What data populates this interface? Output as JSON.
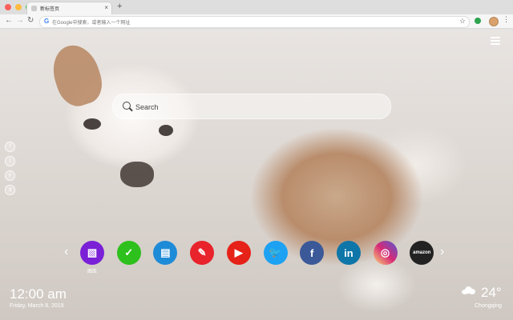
{
  "browser": {
    "tab_title": "新标签页",
    "tab_close": "×",
    "new_tab": "+",
    "omnibox_placeholder": "在Google中搜索，或者输入一个网址",
    "star": "☆",
    "menu": "⋮"
  },
  "page": {
    "search_placeholder": "Search",
    "social_icons": [
      "f",
      "t",
      "p",
      "g"
    ],
    "apps": [
      {
        "name": "gallery",
        "label": "图库",
        "glyph": "▧",
        "color": "#7a20d6"
      },
      {
        "name": "tasks",
        "label": "",
        "glyph": "✓",
        "color": "#2ec01c"
      },
      {
        "name": "notes",
        "label": "",
        "glyph": "▤",
        "color": "#1e8bd8"
      },
      {
        "name": "paint",
        "label": "",
        "glyph": "✎",
        "color": "#e8232b"
      },
      {
        "name": "youtube",
        "label": "",
        "glyph": "▶",
        "color": "#e62117"
      },
      {
        "name": "twitter",
        "label": "",
        "glyph": "🐦",
        "color": "#1da1f2"
      },
      {
        "name": "facebook",
        "label": "",
        "glyph": "f",
        "color": "#3b5998"
      },
      {
        "name": "linkedin",
        "label": "",
        "glyph": "in",
        "color": "#0e76a8"
      },
      {
        "name": "instagram",
        "label": "",
        "glyph": "◎",
        "color": "#d62976"
      },
      {
        "name": "amazon",
        "label": "",
        "glyph": "amazon",
        "color": "#222222"
      }
    ],
    "arrow_left": "‹",
    "arrow_right": "›",
    "time": "12:00 am",
    "date": "Friday, March 8, 2019",
    "temperature": "24°",
    "city": "Chongqing"
  }
}
